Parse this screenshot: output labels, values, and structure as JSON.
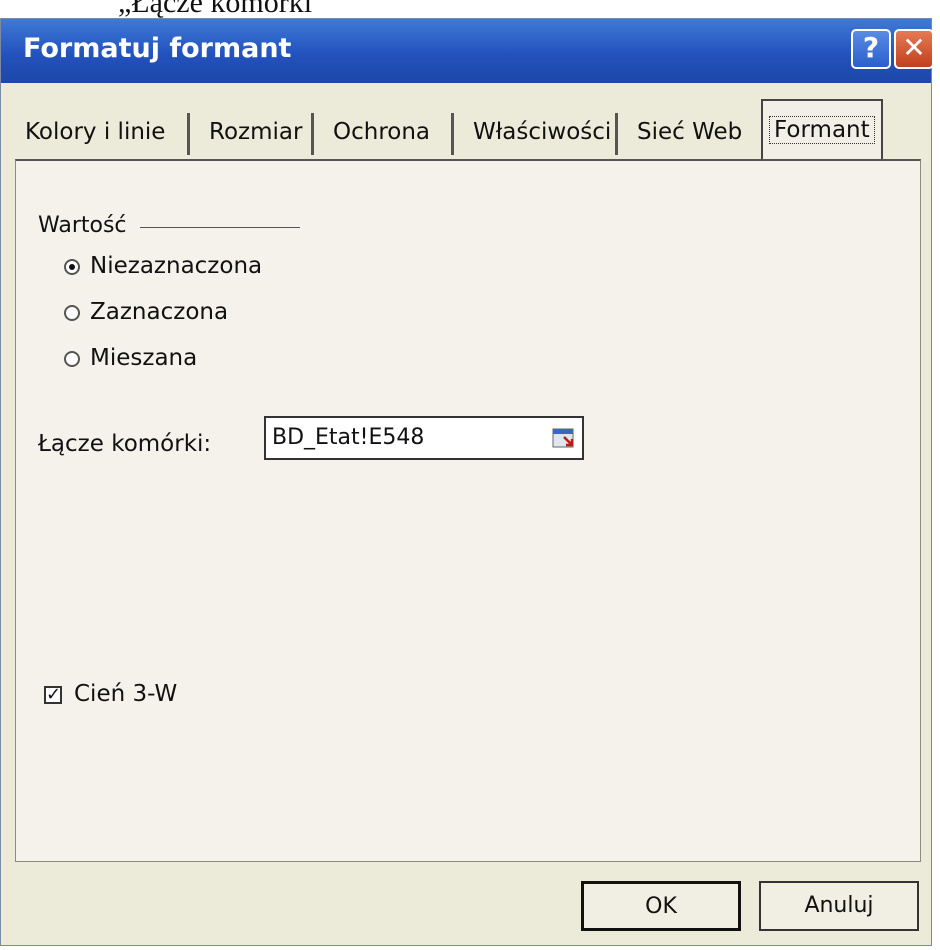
{
  "caption_above": "„Łącze komórki",
  "dialog": {
    "title": "Formatuj formant",
    "help_label": "?",
    "close_label": "✕"
  },
  "tabs": [
    {
      "label": "Kolory i linie",
      "active": false
    },
    {
      "label": "Rozmiar",
      "active": false
    },
    {
      "label": "Ochrona",
      "active": false
    },
    {
      "label": "Właściwości",
      "active": false
    },
    {
      "label": "Sieć Web",
      "active": false
    },
    {
      "label": "Formant",
      "active": true
    }
  ],
  "value_group": {
    "label": "Wartość",
    "options": [
      {
        "label": "Niezaznaczona",
        "selected": true
      },
      {
        "label": "Zaznaczona",
        "selected": false
      },
      {
        "label": "Mieszana",
        "selected": false
      }
    ]
  },
  "cell_link": {
    "label": "Łącze komórki:",
    "value": "BD_Etat!E548"
  },
  "shadow_3d": {
    "label": "Cień 3-W",
    "checked": true,
    "check_mark": "✓"
  },
  "buttons": {
    "ok": "OK",
    "cancel": "Anuluj"
  },
  "colors": {
    "titlebar": "#2352bd",
    "dialog_bg": "#ecead8",
    "close_button": "#c2401d"
  }
}
